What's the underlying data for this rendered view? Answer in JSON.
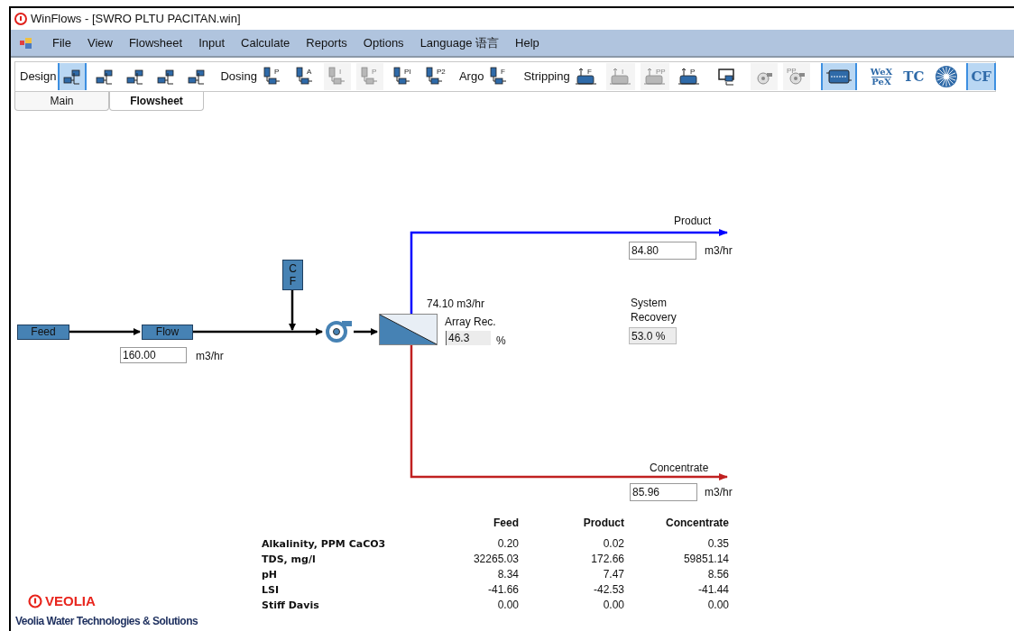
{
  "window": {
    "title": "WinFlows - [SWRO PLTU PACITAN.win]"
  },
  "menu": [
    "File",
    "View",
    "Flowsheet",
    "Input",
    "Calculate",
    "Reports",
    "Options",
    "Language 语言",
    "Help"
  ],
  "toolbar": [
    {
      "kind": "label",
      "text": "Design"
    },
    {
      "kind": "skid",
      "selected": true,
      "disabled": false
    },
    {
      "kind": "skid",
      "selected": false,
      "disabled": false
    },
    {
      "kind": "skid",
      "selected": false,
      "disabled": false
    },
    {
      "kind": "skid",
      "selected": false,
      "disabled": false
    },
    {
      "kind": "skid",
      "selected": false,
      "disabled": false
    },
    {
      "kind": "separator"
    },
    {
      "kind": "label",
      "text": "Dosing"
    },
    {
      "kind": "dosing",
      "letter": "P",
      "selected": false,
      "disabled": false
    },
    {
      "kind": "dosing",
      "letter": "A",
      "selected": false,
      "disabled": false
    },
    {
      "kind": "dosing",
      "letter": "I",
      "selected": false,
      "disabled": true
    },
    {
      "kind": "dosing",
      "letter": "P",
      "selected": false,
      "disabled": true
    },
    {
      "kind": "dosing",
      "letter": "PI",
      "selected": false,
      "disabled": false
    },
    {
      "kind": "dosing",
      "letter": "P2",
      "selected": false,
      "disabled": false
    },
    {
      "kind": "separator"
    },
    {
      "kind": "label",
      "text": "Argo"
    },
    {
      "kind": "dosing",
      "letter": "F",
      "selected": false,
      "disabled": false
    },
    {
      "kind": "separator"
    },
    {
      "kind": "label",
      "text": "Stripping"
    },
    {
      "kind": "tank",
      "letter": "F",
      "selected": false,
      "disabled": false
    },
    {
      "kind": "tank",
      "letter": "I",
      "selected": false,
      "disabled": true
    },
    {
      "kind": "tank",
      "letter": "PP",
      "selected": false,
      "disabled": true
    },
    {
      "kind": "tank",
      "letter": "P",
      "selected": false,
      "disabled": false
    },
    {
      "kind": "separator"
    },
    {
      "kind": "monitor",
      "selected": false,
      "disabled": false
    },
    {
      "kind": "separator"
    },
    {
      "kind": "pump",
      "selected": false,
      "disabled": true
    },
    {
      "kind": "pump",
      "letter": "PP",
      "selected": false,
      "disabled": true
    },
    {
      "kind": "separator"
    },
    {
      "kind": "cartridge",
      "selected": true,
      "disabled": false
    },
    {
      "kind": "separator"
    },
    {
      "kind": "textmark",
      "lines": [
        "WeX",
        "PeX"
      ],
      "selected": false,
      "disabled": false
    },
    {
      "kind": "textmark",
      "lines": [
        "TC"
      ],
      "selected": false,
      "disabled": false
    },
    {
      "kind": "disc",
      "selected": false,
      "disabled": false
    },
    {
      "kind": "textmark",
      "lines": [
        "CF"
      ],
      "selected": true,
      "disabled": false
    }
  ],
  "tabs": [
    {
      "label": "Main",
      "selected": false
    },
    {
      "label": "Flowsheet",
      "selected": true
    }
  ],
  "flowsheet": {
    "feed_button": "Feed",
    "flow_button": "Flow",
    "flow_value": "160.00",
    "flow_unit": "m3/hr",
    "chemical_feed": "CF",
    "array_flow": "74.10 m3/hr",
    "array_rec_label": "Array Rec.",
    "array_rec_value": "46.3",
    "array_rec_unit": "%",
    "product_label": "Product",
    "product_value": "84.80",
    "product_unit": "m3/hr",
    "system_recovery_label": "System Recovery",
    "system_recovery_value": "53.0 %",
    "concentrate_label": "Concentrate",
    "concentrate_value": "85.96",
    "concentrate_unit": "m3/hr"
  },
  "table": {
    "columns": [
      "Feed",
      "Product",
      "Concentrate"
    ],
    "rows": [
      {
        "label": "Alkalinity, PPM CaCO3",
        "values": [
          "0.20",
          "0.02",
          "0.35"
        ]
      },
      {
        "label": "TDS, mg/l",
        "values": [
          "32265.03",
          "172.66",
          "59851.14"
        ]
      },
      {
        "label": "pH",
        "values": [
          "8.34",
          "7.47",
          "8.56"
        ]
      },
      {
        "label": "LSI",
        "values": [
          "-41.66",
          "-42.53",
          "-41.44"
        ]
      },
      {
        "label": "Stiff Davis",
        "values": [
          "0.00",
          "0.00",
          "0.00"
        ]
      }
    ]
  },
  "footer": {
    "logo": "VEOLIA",
    "company": "Veolia Water Technologies & Solutions"
  }
}
